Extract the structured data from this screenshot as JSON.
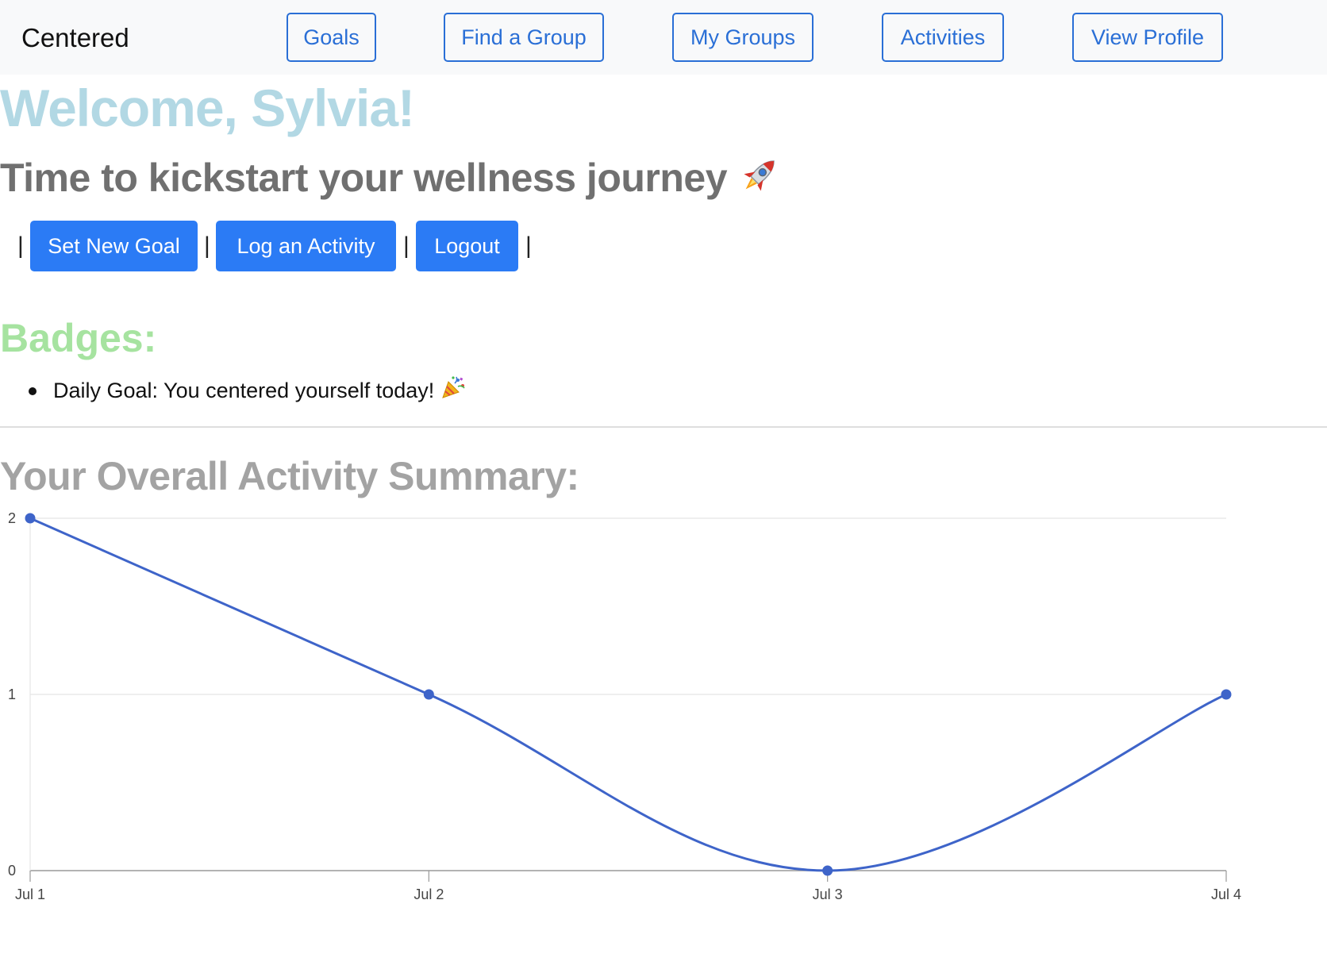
{
  "nav": {
    "brand": "Centered",
    "buttons": [
      "Goals",
      "Find a Group",
      "My Groups",
      "Activities",
      "View Profile"
    ]
  },
  "welcome": "Welcome, Sylvia!",
  "subtitle": "Time to kickstart your wellness journey",
  "subtitle_emoji": "rocket",
  "separator": "|",
  "actions": [
    "Set New Goal",
    "Log an Activity",
    "Logout"
  ],
  "badges": {
    "title": "Badges:",
    "items": [
      "Daily Goal: You centered yourself today!"
    ],
    "item_emoji": "party-popper"
  },
  "summary_title": "Your Overall Activity Summary:",
  "colors": {
    "accent": "#2b7bf5",
    "welcome": "#b2d8e4",
    "badges": "#a6e3a0",
    "series": "#3e64c9"
  },
  "chart_data": {
    "type": "line",
    "categories": [
      "Jul 1",
      "Jul 2",
      "Jul 3",
      "Jul 4"
    ],
    "series": [
      {
        "values": [
          2,
          1,
          0,
          1
        ]
      }
    ],
    "ylim": [
      0,
      2
    ],
    "yticks": [
      0,
      1,
      2
    ],
    "grid": true,
    "smooth": true,
    "title": "",
    "xlabel": "",
    "ylabel": ""
  }
}
